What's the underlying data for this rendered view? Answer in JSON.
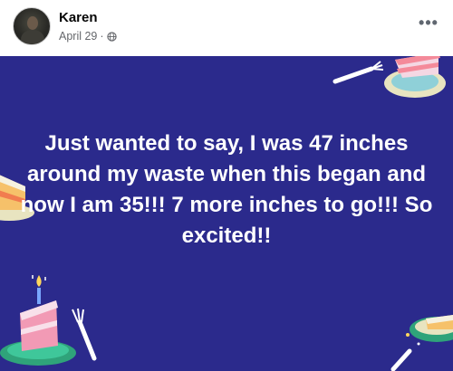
{
  "post": {
    "author": "Karen",
    "date": "April 29",
    "separator": "·",
    "privacy_icon": "globe-icon",
    "more_icon": "more-horizontal-icon",
    "more_label": "•••"
  },
  "background": {
    "color": "#2b2a8c",
    "theme": "birthday-cake-pattern"
  },
  "content": {
    "text": "Just wanted to say, I was 47 inches around my waste when this began and now I am 35!!! 7 more inches to go!!! So excited!!"
  }
}
